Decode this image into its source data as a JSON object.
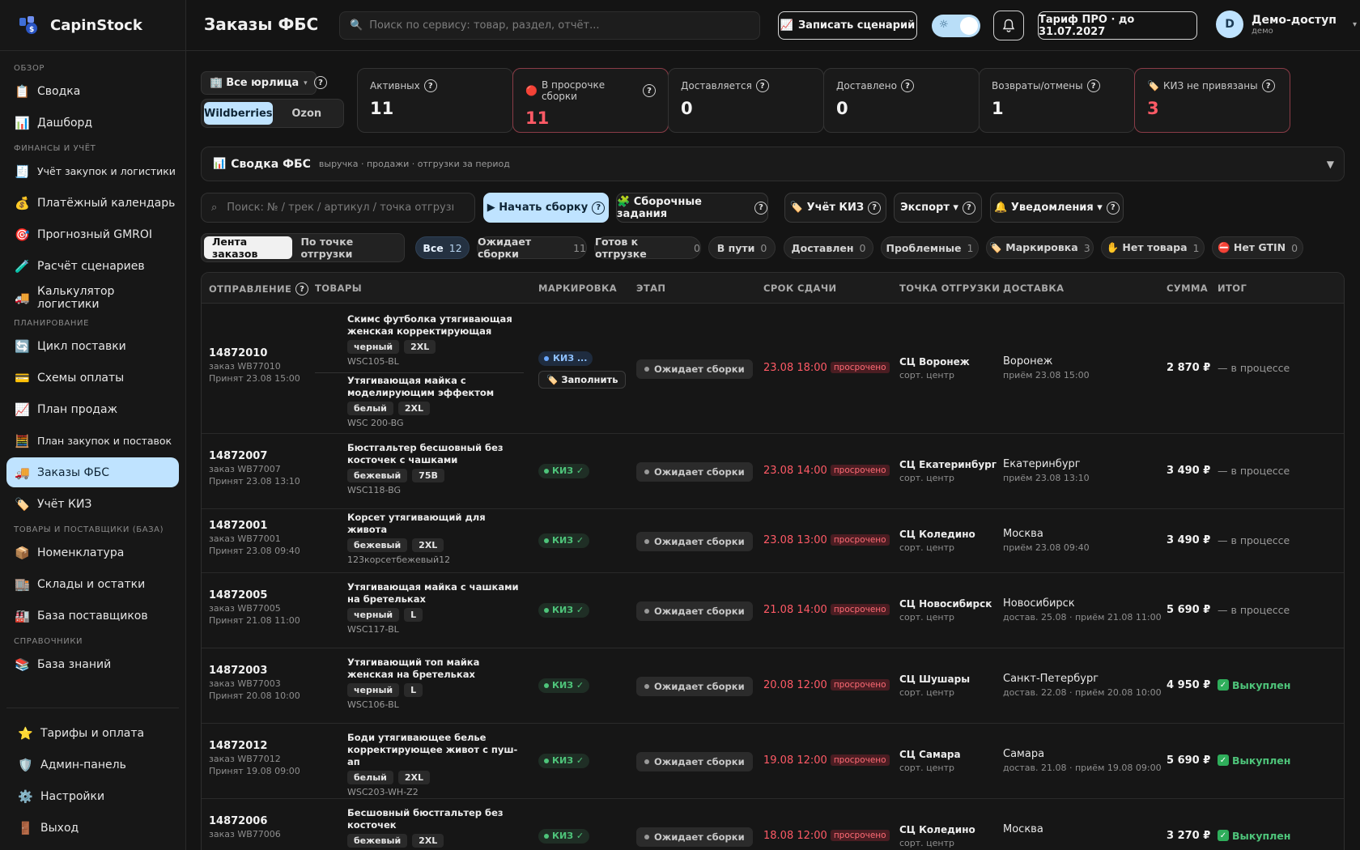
{
  "app": {
    "name": "CapinStock"
  },
  "sidebar": {
    "sections": [
      {
        "title": "ОБЗОР",
        "items": [
          {
            "label": "Сводка",
            "icon": "clipboard-icon"
          },
          {
            "label": "Дашборд",
            "icon": "chart-icon"
          }
        ]
      },
      {
        "title": "ФИНАНСЫ И УЧЁТ",
        "items": [
          {
            "label": "Учёт закупок и логистики",
            "icon": "receipt-icon"
          },
          {
            "label": "Платёжный календарь",
            "icon": "money-bag-icon"
          },
          {
            "label": "Прогнозный GMROI",
            "icon": "target-icon"
          },
          {
            "label": "Расчёт сценариев",
            "icon": "test-tube-icon"
          },
          {
            "label": "Калькулятор логистики",
            "icon": "truck-icon"
          }
        ]
      },
      {
        "title": "ПЛАНИРОВАНИЕ",
        "items": [
          {
            "label": "Цикл поставки",
            "icon": "cycle-icon"
          },
          {
            "label": "Схемы оплаты",
            "icon": "card-icon"
          },
          {
            "label": "План продаж",
            "icon": "trend-icon"
          },
          {
            "label": "План закупок и поставок",
            "icon": "abacus-icon"
          },
          {
            "label": "Заказы ФБС",
            "icon": "delivery-truck-icon",
            "active": true
          },
          {
            "label": "Учёт КИЗ",
            "icon": "tag-icon"
          }
        ]
      },
      {
        "title": "ТОВАРЫ И ПОСТАВЩИКИ (БАЗА)",
        "items": [
          {
            "label": "Номенклатура",
            "icon": "box-icon"
          },
          {
            "label": "Склады и остатки",
            "icon": "warehouse-icon"
          },
          {
            "label": "База поставщиков",
            "icon": "factory-icon"
          }
        ]
      },
      {
        "title": "СПРАВОЧНИКИ",
        "items": [
          {
            "label": "База знаний",
            "icon": "books-icon"
          }
        ]
      }
    ],
    "bottom": [
      {
        "label": "Тарифы и оплата",
        "icon": "star-icon"
      },
      {
        "label": "Админ-панель",
        "icon": "shield-icon"
      },
      {
        "label": "Настройки",
        "icon": "gear-icon"
      },
      {
        "label": "Выход",
        "icon": "door-icon"
      }
    ]
  },
  "topbar": {
    "title": "Заказы ФБС",
    "search_placeholder": "Поиск по сервису: товар, раздел, отчёт...",
    "record_label": "Записать сценарий",
    "tariff_label": "Тариф ПРО · до 31.07.2027",
    "user": {
      "initial": "D",
      "name": "Демо-доступ",
      "sub": "демо"
    }
  },
  "filters": {
    "entity": "Все юрлица",
    "markets": [
      "Wildberries",
      "Ozon"
    ],
    "active_market": "Wildberries"
  },
  "kpis": [
    {
      "label": "Активных",
      "value": "11",
      "alert": false
    },
    {
      "label": "В просрочке сборки",
      "value": "11",
      "alert": true,
      "prefix": "🔴"
    },
    {
      "label": "Доставляется",
      "value": "0",
      "alert": false
    },
    {
      "label": "Доставлено",
      "value": "0",
      "alert": false
    },
    {
      "label": "Возвраты/отмены",
      "value": "1",
      "alert": false
    },
    {
      "label": "КИЗ не привязаны",
      "value": "3",
      "alert": true,
      "prefix": "🏷️"
    }
  ],
  "summary": {
    "title": "Сводка ФБС",
    "subtitle": "выручка · продажи · отгрузки за период"
  },
  "actions": {
    "search_placeholder": "Поиск: № / трек / артикул / точка отгрузки",
    "start": "▶ Начать сборку",
    "tasks": "🧩 Сборочные задания",
    "kiz": "🏷️ Учёт КИЗ",
    "export": "Экспорт ▾",
    "notify": "🔔 Уведомления ▾"
  },
  "views": [
    "Лента заказов",
    "По точке отгрузки"
  ],
  "chips": [
    {
      "label": "Все",
      "count": "12",
      "on": true
    },
    {
      "label": "Ожидает сборки",
      "count": "11"
    },
    {
      "label": "Готов к отгрузке",
      "count": "0"
    },
    {
      "label": "В пути",
      "count": "0"
    },
    {
      "label": "Доставлен",
      "count": "0"
    },
    {
      "label": "Проблемные",
      "count": "1"
    },
    {
      "label": "🏷️ Маркировка",
      "count": "3"
    },
    {
      "label": "✋ Нет товара",
      "count": "1"
    },
    {
      "label": "⛔ Нет GTIN",
      "count": "0"
    }
  ],
  "table": {
    "headers": [
      "ОТПРАВЛЕНИЕ",
      "ТОВАРЫ",
      "МАРКИРОВКА",
      "ЭТАП",
      "СРОК СДАЧИ",
      "ТОЧКА ОТГРУЗКИ",
      "ДОСТАВКА",
      "СУММА",
      "ИТОГ"
    ],
    "kiz_ok": "КИЗ ✓",
    "kiz_pending": "КИЗ ...",
    "fill_label": "🏷️ Заполнить",
    "stage_label": "Ожидает сборки",
    "overdue_label": "просрочено",
    "ship_sub": "сорт. центр",
    "rows": [
      {
        "id": "14872010",
        "order": "заказ WB77010",
        "accepted": "Принят 23.08 15:00",
        "products": [
          {
            "name": "Скимс футболка утягивающая женская корректирующая",
            "tags": [
              "черный",
              "2XL"
            ],
            "sku": "WSC105-BL"
          },
          {
            "name": "Утягивающая майка с моделирующим эффектом",
            "tags": [
              "белый",
              "2XL"
            ],
            "sku": "WSC 200-BG"
          }
        ],
        "kiz": "pending",
        "deadline": "23.08 18:00",
        "ship": "СЦ Воронеж",
        "city": "Воронеж",
        "delivery": "приём 23.08 15:00",
        "sum": "2 870 ₽",
        "result": "— в процессе",
        "done": false
      },
      {
        "id": "14872007",
        "order": "заказ WB77007",
        "accepted": "Принят 23.08 13:10",
        "products": [
          {
            "name": "Бюстгальтер бесшовный без косточек с чашками",
            "tags": [
              "бежевый",
              "75B"
            ],
            "sku": "WSC118-BG"
          }
        ],
        "kiz": "ok",
        "deadline": "23.08 14:00",
        "ship": "СЦ Екатеринбург",
        "city": "Екатеринбург",
        "delivery": "приём 23.08 13:10",
        "sum": "3 490 ₽",
        "result": "— в процессе",
        "done": false
      },
      {
        "id": "14872001",
        "order": "заказ WB77001",
        "accepted": "Принят 23.08 09:40",
        "products": [
          {
            "name": "Корсет утягивающий для живота",
            "tags": [
              "бежевый",
              "2XL"
            ],
            "sku": "123корсетбежевый12"
          }
        ],
        "kiz": "ok",
        "deadline": "23.08 13:00",
        "ship": "СЦ Коледино",
        "city": "Москва",
        "delivery": "приём 23.08 09:40",
        "sum": "3 490 ₽",
        "result": "— в процессе",
        "done": false
      },
      {
        "id": "14872005",
        "order": "заказ WB77005",
        "accepted": "Принят 21.08 11:00",
        "products": [
          {
            "name": "Утягивающая майка с чашками на бретельках",
            "tags": [
              "черный",
              "L"
            ],
            "sku": "WSC117-BL"
          }
        ],
        "kiz": "ok",
        "deadline": "21.08 14:00",
        "ship": "СЦ Новосибирск",
        "city": "Новосибирск",
        "delivery": "достав. 25.08 · приём 21.08 11:00",
        "sum": "5 690 ₽",
        "result": "— в процессе",
        "done": false
      },
      {
        "id": "14872003",
        "order": "заказ WB77003",
        "accepted": "Принят 20.08 10:00",
        "products": [
          {
            "name": "Утягивающий топ майка женская на бретельках",
            "tags": [
              "черный",
              "L"
            ],
            "sku": "WSC106-BL"
          }
        ],
        "kiz": "ok",
        "deadline": "20.08 12:00",
        "ship": "СЦ Шушары",
        "city": "Санкт-Петербург",
        "delivery": "достав. 22.08 · приём 20.08 10:00",
        "sum": "4 950 ₽",
        "result": "Выкуплен",
        "done": true
      },
      {
        "id": "14872012",
        "order": "заказ WB77012",
        "accepted": "Принят 19.08 09:00",
        "products": [
          {
            "name": "Боди утягивающее белье корректирующее живот с пуш-ап",
            "tags": [
              "белый",
              "2XL"
            ],
            "sku": "WSC203-WH-Z2"
          }
        ],
        "kiz": "ok",
        "deadline": "19.08 12:00",
        "ship": "СЦ Самара",
        "city": "Самара",
        "delivery": "достав. 21.08 · приём 19.08 09:00",
        "sum": "5 690 ₽",
        "result": "Выкуплен",
        "done": true
      },
      {
        "id": "14872006",
        "order": "заказ WB77006",
        "accepted": "",
        "products": [
          {
            "name": "Бесшовный бюстгальтер без косточек",
            "tags": [
              "бежевый",
              "2XL"
            ],
            "sku": ""
          }
        ],
        "kiz": "ok",
        "deadline": "18.08 12:00",
        "ship": "СЦ Коледино",
        "city": "Москва",
        "delivery": "",
        "sum": "3 270 ₽",
        "result": "Выкуплен",
        "done": true
      }
    ]
  }
}
